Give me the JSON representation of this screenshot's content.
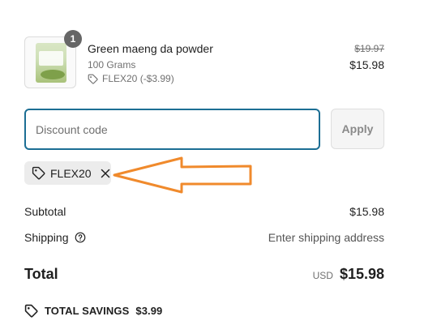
{
  "item": {
    "name": "Green maeng da powder",
    "variant": "100 Grams",
    "discount": "FLEX20 (-$3.99)",
    "quantity": "1",
    "original_price": "$19.97",
    "price": "$15.98"
  },
  "discount_form": {
    "placeholder": "Discount code",
    "apply_label": "Apply"
  },
  "applied_code": "FLEX20",
  "summary": {
    "subtotal_label": "Subtotal",
    "subtotal_value": "$15.98",
    "shipping_label": "Shipping",
    "shipping_value": "Enter shipping address",
    "total_label": "Total",
    "currency": "USD",
    "total_value": "$15.98",
    "savings_label": "TOTAL SAVINGS",
    "savings_value": "$3.99"
  },
  "icons": {
    "tag": "tag-icon",
    "close": "close-icon",
    "help": "help-circle-icon",
    "annotation": "arrow-annotation"
  },
  "colors": {
    "focus_border": "#1c6e94",
    "arrow": "#f08a2c",
    "badge": "#666666"
  }
}
